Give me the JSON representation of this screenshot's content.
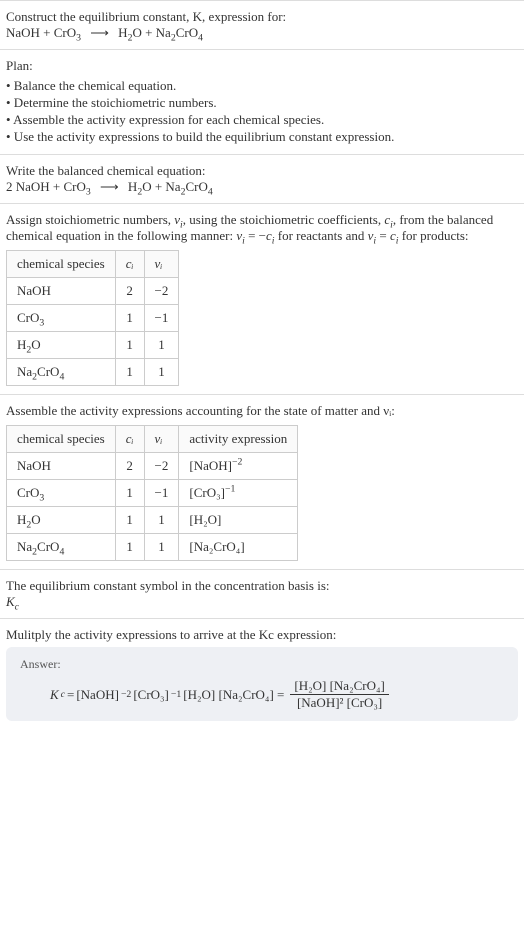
{
  "intro": {
    "line1": "Construct the equilibrium constant, K, expression for:",
    "eq_lhs1": "NaOH + CrO",
    "eq_lhs_sub": "3",
    "arrow": "⟶",
    "eq_rhs1": "H",
    "eq_rhs1_sub": "2",
    "eq_rhs2": "O + Na",
    "eq_rhs2_sub": "2",
    "eq_rhs3": "CrO",
    "eq_rhs3_sub": "4"
  },
  "plan": {
    "title": "Plan:",
    "items": [
      "• Balance the chemical equation.",
      "• Determine the stoichiometric numbers.",
      "• Assemble the activity expression for each chemical species.",
      "• Use the activity expressions to build the equilibrium constant expression."
    ]
  },
  "balanced": {
    "title": "Write the balanced chemical equation:",
    "lhs1": "2 NaOH + CrO",
    "lhs1_sub": "3",
    "arrow": "⟶",
    "rhs1": "H",
    "rhs1_sub": "2",
    "rhs2": "O + Na",
    "rhs2_sub": "2",
    "rhs3": "CrO",
    "rhs3_sub": "4"
  },
  "assign": {
    "p1a": "Assign stoichiometric numbers, ",
    "nu": "ν",
    "isub": "i",
    "p1b": ", using the stoichiometric coefficients, ",
    "c": "c",
    "p1c": ", from the balanced chemical equation in the following manner: ",
    "eq1a": "ν",
    "eq_is": "i",
    "eq1b": " = −",
    "eq1c": "c",
    "p1d": " for reactants and ",
    "eq2a": "ν",
    "eq2b": " = ",
    "eq2c": "c",
    "p1e": " for products:",
    "headers": [
      "chemical species",
      "cᵢ",
      "νᵢ"
    ],
    "rows": [
      {
        "sp": "NaOH",
        "sub": "",
        "c": "2",
        "v": "−2"
      },
      {
        "sp": "CrO",
        "sub": "3",
        "c": "1",
        "v": "−1"
      },
      {
        "sp": "H",
        "sub": "2",
        "sp2": "O",
        "c": "1",
        "v": "1"
      },
      {
        "sp": "Na",
        "sub": "2",
        "sp2": "CrO",
        "sub2": "4",
        "c": "1",
        "v": "1"
      }
    ]
  },
  "assemble": {
    "title": "Assemble the activity expressions accounting for the state of matter and νᵢ:",
    "headers": [
      "chemical species",
      "cᵢ",
      "νᵢ",
      "activity expression"
    ],
    "rows": [
      {
        "sp": "NaOH",
        "sub": "",
        "c": "2",
        "v": "−2",
        "act": "[NaOH]",
        "exp": "−2"
      },
      {
        "sp": "CrO",
        "sub": "3",
        "c": "1",
        "v": "−1",
        "act": "[CrO₃]",
        "exp": "−1"
      },
      {
        "sp": "H",
        "sub": "2",
        "sp2": "O",
        "c": "1",
        "v": "1",
        "act": "[H₂O]",
        "exp": ""
      },
      {
        "sp": "Na",
        "sub": "2",
        "sp2": "CrO",
        "sub2": "4",
        "c": "1",
        "v": "1",
        "act": "[Na₂CrO₄]",
        "exp": ""
      }
    ]
  },
  "symbol": {
    "line1": "The equilibrium constant symbol in the concentration basis is:",
    "kc_k": "K",
    "kc_c": "c"
  },
  "mult": {
    "title": "Mulitply the activity expressions to arrive at the Kc expression:"
  },
  "answer": {
    "label": "Answer:",
    "kc_k": "K",
    "kc_c": "c",
    "eq": " = ",
    "t1": "[NaOH]",
    "e1": "−2",
    "t2": " [CrO₃]",
    "e2": "−1",
    "t3": " [H₂O] [Na₂CrO₄] = ",
    "num": "[H₂O] [Na₂CrO₄]",
    "den": "[NaOH]² [CrO₃]"
  },
  "chart_data": {
    "type": "table",
    "tables": [
      {
        "title": "Stoichiometric numbers",
        "columns": [
          "chemical species",
          "c_i",
          "ν_i"
        ],
        "rows": [
          [
            "NaOH",
            2,
            -2
          ],
          [
            "CrO3",
            1,
            -1
          ],
          [
            "H2O",
            1,
            1
          ],
          [
            "Na2CrO4",
            1,
            1
          ]
        ]
      },
      {
        "title": "Activity expressions",
        "columns": [
          "chemical species",
          "c_i",
          "ν_i",
          "activity expression"
        ],
        "rows": [
          [
            "NaOH",
            2,
            -2,
            "[NaOH]^-2"
          ],
          [
            "CrO3",
            1,
            -1,
            "[CrO3]^-1"
          ],
          [
            "H2O",
            1,
            1,
            "[H2O]"
          ],
          [
            "Na2CrO4",
            1,
            1,
            "[Na2CrO4]"
          ]
        ]
      }
    ]
  }
}
